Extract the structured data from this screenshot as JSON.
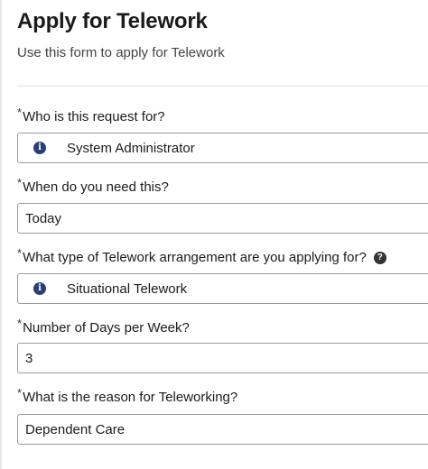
{
  "header": {
    "title": "Apply for Telework",
    "subtitle": "Use this form to apply for Telework"
  },
  "required_marker": "*",
  "fields": [
    {
      "label": "Who is this request for?",
      "value": "System Administrator",
      "icon": "info-icon"
    },
    {
      "label": "When do you need this?",
      "value": "Today"
    },
    {
      "label": "What type of Telework arrangement are you applying for?",
      "value": "Situational Telework",
      "icon": "info-icon",
      "help_icon": "question-icon"
    },
    {
      "label": "Number of Days per Week?",
      "value": "3"
    },
    {
      "label": "What is the reason for Teleworking?",
      "value": "Dependent Care"
    }
  ],
  "colors": {
    "info_icon": "#2a3f78",
    "help_icon": "#333333",
    "field_border": "#9b9b9b",
    "divider": "#e2e2e2"
  }
}
